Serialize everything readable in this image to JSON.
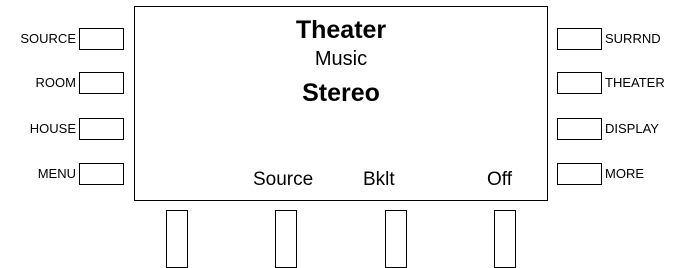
{
  "left_buttons": [
    {
      "label": "SOURCE"
    },
    {
      "label": "ROOM"
    },
    {
      "label": "HOUSE"
    },
    {
      "label": "MENU"
    }
  ],
  "right_buttons": [
    {
      "label": "SURRND"
    },
    {
      "label": "THEATER"
    },
    {
      "label": "DISPLAY"
    },
    {
      "label": "MORE"
    }
  ],
  "display": {
    "line1": "Theater",
    "line2": "Music",
    "line3": "Stereo",
    "softkeys": [
      "Source",
      "Bklt",
      "Off"
    ]
  }
}
